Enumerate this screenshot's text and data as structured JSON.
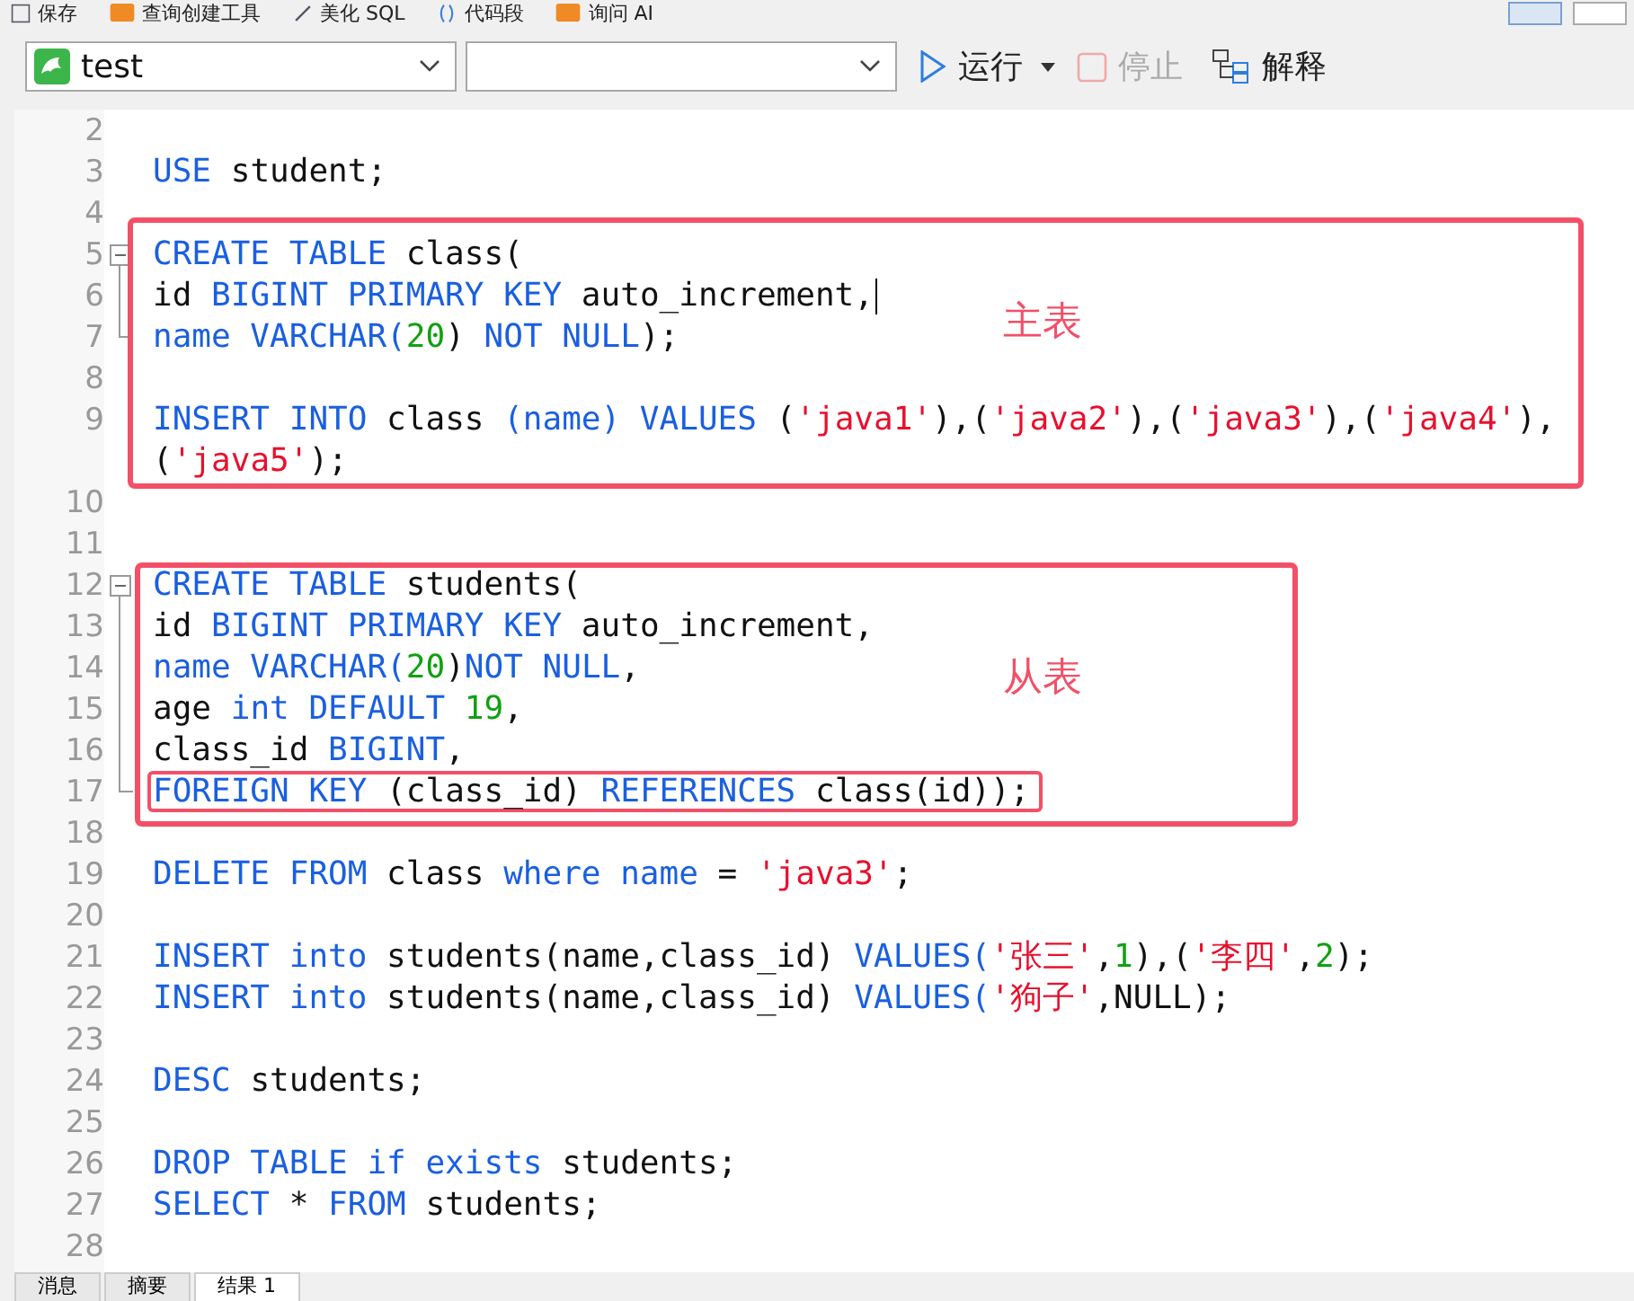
{
  "top_toolbar": {
    "items": [
      {
        "label": "保存"
      },
      {
        "label": "查询创建工具"
      },
      {
        "label": "美化 SQL"
      },
      {
        "label": "代码段"
      },
      {
        "label": "询问 AI"
      }
    ]
  },
  "query_toolbar": {
    "database": {
      "value": "test"
    },
    "run": {
      "label": "运行",
      "disabled": false
    },
    "stop": {
      "label": "停止",
      "disabled": true
    },
    "explain": {
      "label": "解释",
      "disabled": false
    }
  },
  "editor": {
    "lines": [
      {
        "number": "2"
      },
      {
        "number": "3",
        "tokens": [
          {
            "text": "USE",
            "kind": "keyword"
          },
          {
            "text": " student;",
            "kind": "plain"
          }
        ]
      },
      {
        "number": "4"
      },
      {
        "number": "5",
        "tokens": [
          {
            "text": "CREATE TABLE",
            "kind": "keyword"
          },
          {
            "text": " class(",
            "kind": "plain"
          }
        ],
        "children": [
          {
            "number": "6",
            "cursor": true,
            "tokens": [
              {
                "text": "id ",
                "kind": "plain"
              },
              {
                "text": "BIGINT PRIMARY KEY",
                "kind": "keyword"
              },
              {
                "text": " auto_increment,",
                "kind": "plain"
              }
            ]
          },
          {
            "number": "7",
            "tokens": [
              {
                "text": "name VARCHAR(",
                "kind": "keyword"
              },
              {
                "text": "20",
                "kind": "number"
              },
              {
                "text": ") ",
                "kind": "plain"
              },
              {
                "text": "NOT NULL",
                "kind": "keyword"
              },
              {
                "text": ");",
                "kind": "plain"
              }
            ]
          }
        ]
      },
      {
        "number": "8"
      },
      {
        "number": "9",
        "tokens": [
          {
            "text": "INSERT INTO",
            "kind": "keyword"
          },
          {
            "text": " class ",
            "kind": "plain"
          },
          {
            "text": "(name) VALUES",
            "kind": "keyword"
          },
          {
            "text": " (",
            "kind": "plain"
          },
          {
            "text": "'java1'",
            "kind": "string"
          },
          {
            "text": "),(",
            "kind": "plain"
          },
          {
            "text": "'java2'",
            "kind": "string"
          },
          {
            "text": "),(",
            "kind": "plain"
          },
          {
            "text": "'java3'",
            "kind": "string"
          },
          {
            "text": "),(",
            "kind": "plain"
          },
          {
            "text": "'java4'",
            "kind": "string"
          },
          {
            "text": "),",
            "kind": "plain"
          }
        ]
      },
      {
        "tokens": [
          {
            "text": "(",
            "kind": "plain"
          },
          {
            "text": "'java5'",
            "kind": "string"
          },
          {
            "text": ");",
            "kind": "plain"
          }
        ]
      },
      {
        "number": "10"
      },
      {
        "number": "11"
      },
      {
        "number": "12",
        "tokens": [
          {
            "text": "CREATE TABLE",
            "kind": "keyword"
          },
          {
            "text": " students(",
            "kind": "plain"
          }
        ],
        "children": [
          {
            "number": "13",
            "tokens": [
              {
                "text": "id ",
                "kind": "plain"
              },
              {
                "text": "BIGINT PRIMARY KEY",
                "kind": "keyword"
              },
              {
                "text": " auto_increment,",
                "kind": "plain"
              }
            ]
          },
          {
            "number": "14",
            "tokens": [
              {
                "text": "name VARCHAR(",
                "kind": "keyword"
              },
              {
                "text": "20",
                "kind": "number"
              },
              {
                "text": ")",
                "kind": "plain"
              },
              {
                "text": "NOT NULL",
                "kind": "keyword"
              },
              {
                "text": ",",
                "kind": "plain"
              }
            ]
          },
          {
            "number": "15",
            "tokens": [
              {
                "text": "age ",
                "kind": "plain"
              },
              {
                "text": "int DEFAULT ",
                "kind": "keyword"
              },
              {
                "text": "19",
                "kind": "number"
              },
              {
                "text": ",",
                "kind": "plain"
              }
            ]
          },
          {
            "number": "16",
            "tokens": [
              {
                "text": "class_id ",
                "kind": "plain"
              },
              {
                "text": "BIGINT",
                "kind": "keyword"
              },
              {
                "text": ",",
                "kind": "plain"
              }
            ]
          },
          {
            "number": "17",
            "boxed": true,
            "tokens": [
              {
                "text": "FOREIGN KEY",
                "kind": "keyword"
              },
              {
                "text": " (class_id) ",
                "kind": "plain"
              },
              {
                "text": "REFERENCES",
                "kind": "keyword"
              },
              {
                "text": " class(id));",
                "kind": "plain"
              }
            ]
          }
        ]
      },
      {
        "number": "18"
      },
      {
        "number": "19",
        "tokens": [
          {
            "text": "DELETE FROM",
            "kind": "keyword"
          },
          {
            "text": " class ",
            "kind": "plain"
          },
          {
            "text": "where name",
            "kind": "keyword"
          },
          {
            "text": " = ",
            "kind": "plain"
          },
          {
            "text": "'java3'",
            "kind": "string"
          },
          {
            "text": ";",
            "kind": "plain"
          }
        ]
      },
      {
        "number": "20"
      },
      {
        "number": "21",
        "tokens": [
          {
            "text": "INSERT into",
            "kind": "keyword"
          },
          {
            "text": " students(name,class_id) ",
            "kind": "plain"
          },
          {
            "text": "VALUES(",
            "kind": "keyword"
          },
          {
            "text": "'张三'",
            "kind": "string"
          },
          {
            "text": ",",
            "kind": "plain"
          },
          {
            "text": "1",
            "kind": "number"
          },
          {
            "text": "),(",
            "kind": "plain"
          },
          {
            "text": "'李四'",
            "kind": "string"
          },
          {
            "text": ",",
            "kind": "plain"
          },
          {
            "text": "2",
            "kind": "number"
          },
          {
            "text": ");",
            "kind": "plain"
          }
        ]
      },
      {
        "number": "22",
        "tokens": [
          {
            "text": "INSERT into",
            "kind": "keyword"
          },
          {
            "text": " students(name,class_id) ",
            "kind": "plain"
          },
          {
            "text": "VALUES(",
            "kind": "keyword"
          },
          {
            "text": "'狗子'",
            "kind": "string"
          },
          {
            "text": ",NULL);",
            "kind": "plain"
          }
        ]
      },
      {
        "number": "23"
      },
      {
        "number": "24",
        "tokens": [
          {
            "text": "DESC",
            "kind": "keyword"
          },
          {
            "text": " students;",
            "kind": "plain"
          }
        ]
      },
      {
        "number": "25"
      },
      {
        "number": "26",
        "tokens": [
          {
            "text": "DROP TABLE if exists",
            "kind": "keyword"
          },
          {
            "text": " students;",
            "kind": "plain"
          }
        ]
      },
      {
        "number": "27",
        "tokens": [
          {
            "text": "SELECT",
            "kind": "keyword"
          },
          {
            "text": " * ",
            "kind": "plain"
          },
          {
            "text": "FROM",
            "kind": "keyword"
          },
          {
            "text": " students;",
            "kind": "plain"
          }
        ]
      },
      {
        "number": "28"
      }
    ]
  },
  "annotations": [
    {
      "label": "主表"
    },
    {
      "label": "从表"
    }
  ],
  "result_tabs": [
    {
      "label": "消息",
      "selected": false
    },
    {
      "label": "摘要",
      "selected": false
    },
    {
      "label": "结果 1",
      "selected": true
    }
  ]
}
